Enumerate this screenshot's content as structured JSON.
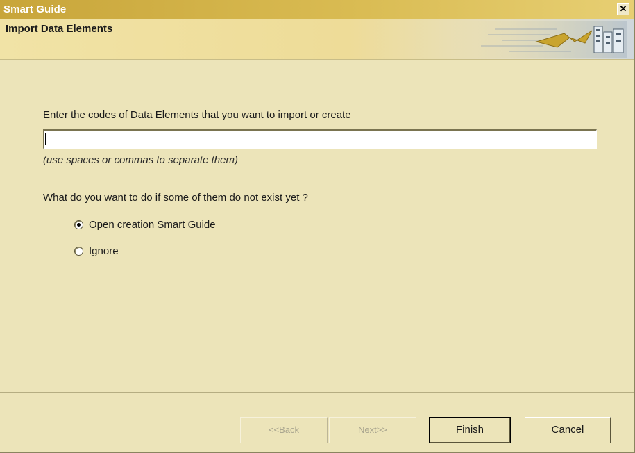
{
  "window": {
    "title": "Smart Guide",
    "close_glyph": "✕"
  },
  "header": {
    "title": "Import Data Elements"
  },
  "form": {
    "prompt": "Enter the codes of Data Elements that you want to import or create",
    "codes_value": "",
    "hint": "(use spaces or commas to separate them)",
    "question": "What do you want to do if some of them do not exist yet ?",
    "options": [
      {
        "label": "Open creation Smart Guide",
        "selected": true
      },
      {
        "label": "Ignore",
        "selected": false
      }
    ]
  },
  "buttons": {
    "back": {
      "prefix": "<<",
      "mnemonic": "B",
      "rest": "ack",
      "enabled": false
    },
    "next": {
      "prefix": "",
      "mnemonic": "N",
      "rest": "ext>>",
      "enabled": false
    },
    "finish": {
      "mnemonic": "F",
      "rest": "inish",
      "enabled": true
    },
    "cancel": {
      "mnemonic": "C",
      "rest": "ancel",
      "enabled": true
    }
  },
  "colors": {
    "window_bg": "#ece4b9",
    "title_gold": "#c8a53a",
    "header_band": "#f1e3a6"
  },
  "icons": {
    "header_art": "lightning-circuit-icon",
    "close": "close-icon"
  }
}
